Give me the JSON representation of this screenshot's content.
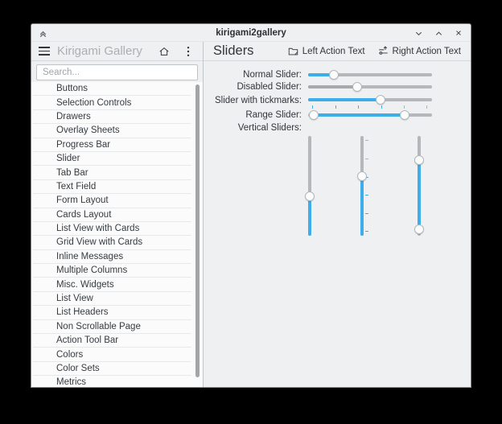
{
  "titlebar": {
    "title": "kirigami2gallery"
  },
  "sidebar": {
    "app_title": "Kirigami Gallery",
    "search_placeholder": "Search...",
    "items": [
      "Buttons",
      "Selection Controls",
      "Drawers",
      "Overlay Sheets",
      "Progress Bar",
      "Slider",
      "Tab Bar",
      "Text Field",
      "Form Layout",
      "Cards Layout",
      "List View with Cards",
      "Grid View with Cards",
      "Inline Messages",
      "Multiple Columns",
      "Misc. Widgets",
      "List View",
      "List Headers",
      "Non Scrollable Page",
      "Action Tool Bar",
      "Colors",
      "Color Sets",
      "Metrics"
    ]
  },
  "main": {
    "page_title": "Sliders",
    "actions": {
      "left_label": "Left Action Text",
      "right_label": "Right Action Text"
    },
    "sliders": {
      "normal": {
        "label": "Normal Slider:",
        "pct": 18
      },
      "disabled": {
        "label": "Disabled Slider:",
        "pct": 39
      },
      "tickmarks": {
        "label": "Slider with tickmarks:",
        "pct": 59
      },
      "range": {
        "label": "Range Slider:",
        "lo_pct": 1,
        "hi_pct": 80
      },
      "vertical_label": "Vertical Sliders:",
      "vertical1": {
        "pct": 38
      },
      "vertical2": {
        "pct": 61
      },
      "vertical3": {
        "lo_pct": 2,
        "hi_pct": 79
      }
    },
    "colors": {
      "accent": "#3daee9",
      "track": "#b4b8ba",
      "disabled_fill": "#a7aaad"
    }
  }
}
